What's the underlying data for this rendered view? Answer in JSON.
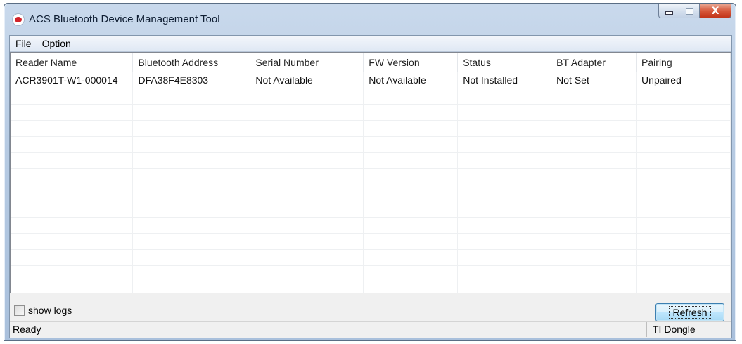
{
  "window": {
    "title": "ACS Bluetooth Device Management Tool",
    "close_glyph": "X"
  },
  "menu": {
    "file": {
      "accel": "F",
      "rest": "ile"
    },
    "option": {
      "accel": "O",
      "rest": "ption"
    }
  },
  "table": {
    "columns": [
      "Reader Name",
      "Bluetooth Address",
      "Serial Number",
      "FW Version",
      "Status",
      "BT Adapter",
      "Pairing"
    ],
    "rows": [
      [
        "ACR3901T-W1-000014",
        "DFA38F4E8303",
        "Not Available",
        "Not Available",
        "Not Installed",
        "Not Set",
        "Unpaired"
      ]
    ]
  },
  "show_logs": {
    "label": "show logs",
    "checked": false
  },
  "refresh_button": {
    "accel": "R",
    "rest": "efresh"
  },
  "statusbar": {
    "left": "Ready",
    "right": "TI Dongle"
  }
}
